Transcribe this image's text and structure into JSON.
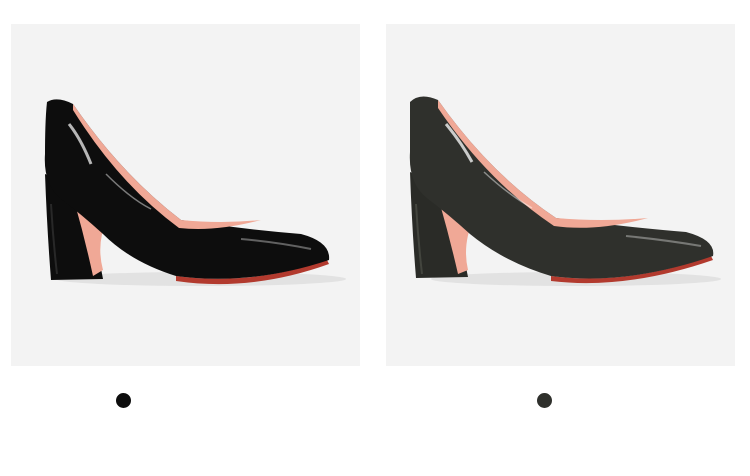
{
  "products": [
    {
      "image": "black-patent-block-heel-pump",
      "color_hex": "#0d0d0d"
    },
    {
      "image": "dark-olive-patent-block-heel-pump",
      "color_hex": "#2f302c"
    }
  ],
  "colors": {
    "panel_background": "#f3f3f3",
    "lining_pink": "#f0a896",
    "sole_red": "#b23a2e"
  }
}
